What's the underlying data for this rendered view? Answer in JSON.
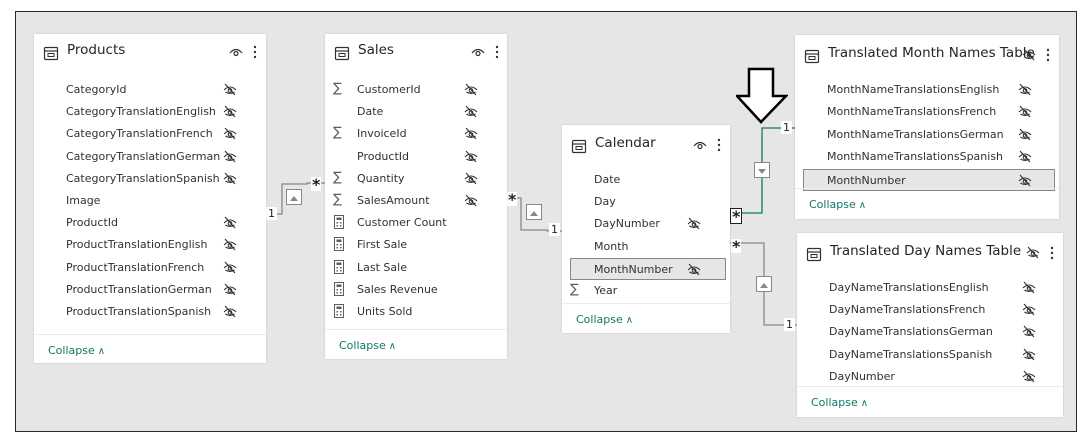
{
  "tables": {
    "products": {
      "title": "Products",
      "fields": [
        {
          "name": "CategoryId",
          "hidden": true
        },
        {
          "name": "CategoryTranslationEnglish",
          "hidden": true
        },
        {
          "name": "CategoryTranslationFrench",
          "hidden": true
        },
        {
          "name": "CategoryTranslationGerman",
          "hidden": true
        },
        {
          "name": "CategoryTranslationSpanish",
          "hidden": true
        },
        {
          "name": "Image",
          "hidden": false
        },
        {
          "name": "ProductId",
          "hidden": true
        },
        {
          "name": "ProductTranslationEnglish",
          "hidden": true
        },
        {
          "name": "ProductTranslationFrench",
          "hidden": true
        },
        {
          "name": "ProductTranslationGerman",
          "hidden": true
        },
        {
          "name": "ProductTranslationSpanish",
          "hidden": true
        }
      ],
      "collapse": "Collapse"
    },
    "sales": {
      "title": "Sales",
      "fields": [
        {
          "name": "CustomerId",
          "icon": "sigma",
          "hidden": true
        },
        {
          "name": "Date",
          "icon": "",
          "hidden": true
        },
        {
          "name": "InvoiceId",
          "icon": "sigma",
          "hidden": true
        },
        {
          "name": "ProductId",
          "icon": "",
          "hidden": true
        },
        {
          "name": "Quantity",
          "icon": "sigma",
          "hidden": true
        },
        {
          "name": "SalesAmount",
          "icon": "sigma",
          "hidden": true
        },
        {
          "name": "Customer Count",
          "icon": "calculator",
          "hidden": false
        },
        {
          "name": "First Sale",
          "icon": "calculator",
          "hidden": false
        },
        {
          "name": "Last Sale",
          "icon": "calculator",
          "hidden": false
        },
        {
          "name": "Sales Revenue",
          "icon": "calculator",
          "hidden": false
        },
        {
          "name": "Units Sold",
          "icon": "calculator",
          "hidden": false
        }
      ],
      "collapse": "Collapse"
    },
    "calendar": {
      "title": "Calendar",
      "fields": [
        {
          "name": "Date",
          "icon": "",
          "hidden": false
        },
        {
          "name": "Day",
          "icon": "",
          "hidden": false
        },
        {
          "name": "DayNumber",
          "icon": "",
          "hidden": true
        },
        {
          "name": "Month",
          "icon": "",
          "hidden": false
        },
        {
          "name": "MonthNumber",
          "icon": "",
          "hidden": true,
          "selected": true
        },
        {
          "name": "Year",
          "icon": "sigma",
          "hidden": false
        }
      ],
      "collapse": "Collapse"
    },
    "month_names": {
      "title": "Translated Month Names Table",
      "fields": [
        {
          "name": "MonthNameTranslationsEnglish",
          "hidden": true
        },
        {
          "name": "MonthNameTranslationsFrench",
          "hidden": true
        },
        {
          "name": "MonthNameTranslationsGerman",
          "hidden": true
        },
        {
          "name": "MonthNameTranslationsSpanish",
          "hidden": true
        },
        {
          "name": "MonthNumber",
          "hidden": true,
          "selected": true
        }
      ],
      "collapse": "Collapse"
    },
    "day_names": {
      "title": "Translated Day Names Table",
      "fields": [
        {
          "name": "DayNameTranslationsEnglish",
          "hidden": true
        },
        {
          "name": "DayNameTranslationsFrench",
          "hidden": true
        },
        {
          "name": "DayNameTranslationsGerman",
          "hidden": true
        },
        {
          "name": "DayNameTranslationsSpanish",
          "hidden": true
        },
        {
          "name": "DayNumber",
          "hidden": true
        }
      ],
      "collapse": "Collapse"
    }
  },
  "relationships": {
    "products_sales": {
      "one": "1",
      "many": "*"
    },
    "sales_calendar": {
      "many": "*",
      "one": "1"
    },
    "calendar_month": {
      "many": "*",
      "one": "1"
    },
    "calendar_day": {
      "many": "*",
      "one": "1"
    }
  },
  "colors": {
    "active_relationship": "#117865",
    "relationship": "#8a8886",
    "accent_text": "#117865"
  },
  "icons": {
    "table": "table-icon",
    "visible": "eye-icon",
    "hidden": "eye-hidden-icon",
    "more": "more-options-icon",
    "measure": "calculator-icon",
    "sum": "sigma-icon",
    "annotation": "down-arrow-annotation"
  }
}
